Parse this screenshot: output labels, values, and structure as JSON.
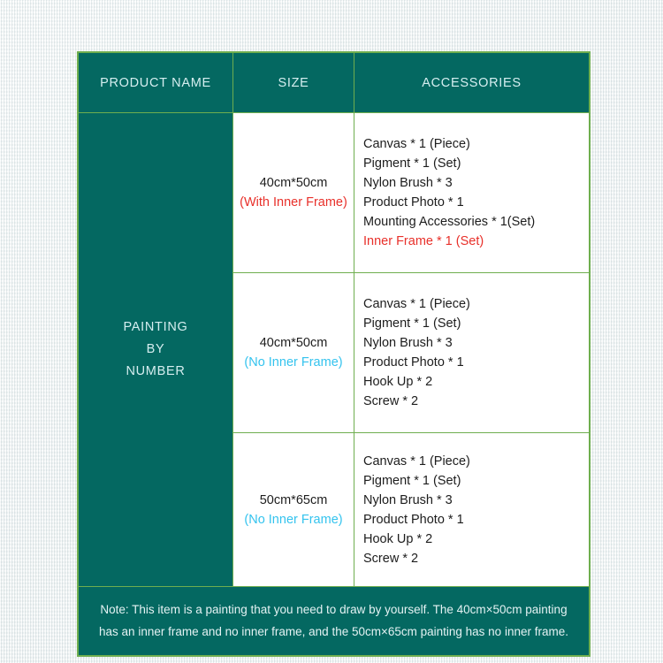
{
  "table": {
    "headers": [
      {
        "label": "PRODUCT NAME"
      },
      {
        "label": "SIZE"
      },
      {
        "label": "ACCESSORIES"
      }
    ],
    "product_name": {
      "line1": "PAINTING",
      "line2": "BY",
      "line3": "NUMBER"
    },
    "rows": [
      {
        "size": "40cm*50cm",
        "size_note": "(With Inner Frame)",
        "size_note_color": "#e8302a",
        "accessories": [
          {
            "text": "Canvas * 1 (Piece)",
            "color": "#1d1d1d"
          },
          {
            "text": "Pigment * 1 (Set)",
            "color": "#1d1d1d"
          },
          {
            "text": "Nylon Brush * 3",
            "color": "#1d1d1d"
          },
          {
            "text": "Product Photo * 1",
            "color": "#1d1d1d"
          },
          {
            "text": "Mounting Accessories * 1(Set)",
            "color": "#1d1d1d"
          },
          {
            "text": "Inner Frame * 1 (Set)",
            "color": "#e8302a"
          }
        ]
      },
      {
        "size": "40cm*50cm",
        "size_note": "(No Inner Frame)",
        "size_note_color": "#34c3ee",
        "accessories": [
          {
            "text": "Canvas * 1 (Piece)",
            "color": "#1d1d1d"
          },
          {
            "text": "Pigment * 1 (Set)",
            "color": "#1d1d1d"
          },
          {
            "text": "Nylon Brush * 3",
            "color": "#1d1d1d"
          },
          {
            "text": "Product Photo * 1",
            "color": "#1d1d1d"
          },
          {
            "text": "Hook Up * 2",
            "color": "#1d1d1d"
          },
          {
            "text": "Screw * 2",
            "color": "#1d1d1d"
          }
        ]
      },
      {
        "size": "50cm*65cm",
        "size_note": "(No Inner Frame)",
        "size_note_color": "#34c3ee",
        "accessories": [
          {
            "text": "Canvas * 1 (Piece)",
            "color": "#1d1d1d"
          },
          {
            "text": "Pigment * 1 (Set)",
            "color": "#1d1d1d"
          },
          {
            "text": "Nylon Brush * 3",
            "color": "#1d1d1d"
          },
          {
            "text": "Product Photo * 1",
            "color": "#1d1d1d"
          },
          {
            "text": "Hook Up * 2",
            "color": "#1d1d1d"
          },
          {
            "text": "Screw * 2",
            "color": "#1d1d1d"
          }
        ]
      }
    ],
    "footer_note": "Note: This item is a painting that you need to draw by yourself. The 40cm×50cm painting has an inner frame and no inner frame, and the 50cm×65cm painting has no inner frame."
  },
  "colors": {
    "header_background": "#046861",
    "header_text": "#d6eef0",
    "border": "#6fae4f",
    "cell_background": "#ffffff",
    "body_text": "#1d1d1d",
    "accent_red": "#e8302a",
    "accent_cyan": "#34c3ee",
    "page_background": "#eef2f2"
  }
}
